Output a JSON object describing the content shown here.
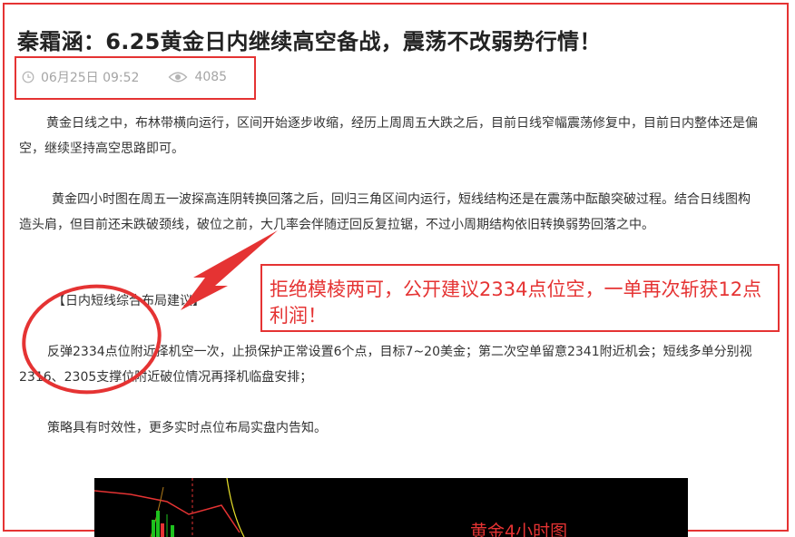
{
  "article": {
    "title": "秦霜涵：6.25黄金日内继续高空备战，震荡不改弱势行情！",
    "meta": {
      "date": "06月25日 09:52",
      "views": "4085",
      "date_icon": "clock-icon",
      "views_icon": "eye-icon"
    },
    "paragraphs": [
      "黄金日线之中，布林带横向运行，区间开始逐步收缩，经历上周周五大跌之后，目前日线窄幅震荡修复中，目前日内整体还是偏空，继续坚持高空思路即可。",
      "黄金四小时图在周五一波探高连阴转换回落之后，回归三角区间内运行，短线结构还是在震荡中酝酿突破过程。结合日线图构造头肩，但目前还未跌破颈线，破位之前，大几率会伴随迂回反复拉锯，不过小周期结构依旧转换弱势回落之中。",
      "【日内短线综合布局建议】",
      "反弹2334点位附近择机空一次，止损保护正常设置6个点，目标7~20美金；第二次空单留意2341附近机会；短线多单分别视2316、2305支撑位附近破位情况再择机临盘安排；",
      "策略具有时效性，更多实时点位布局实盘内告知。"
    ]
  },
  "annotation": {
    "callout": "拒绝模棱两可，公开建议2334点位空，一单再次斩获12点利润！",
    "chart_label": "黄金4小时图"
  },
  "colors": {
    "accent": "#e53333",
    "text": "#333333",
    "meta": "#a5a5a5",
    "chart_bg": "#000000"
  }
}
